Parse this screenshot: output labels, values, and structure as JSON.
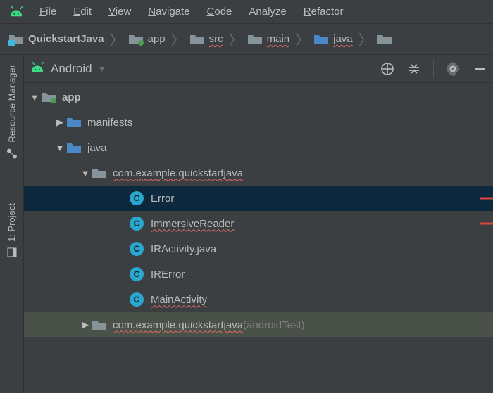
{
  "menu": {
    "file": "File",
    "edit": "Edit",
    "view": "View",
    "navigate": "Navigate",
    "code": "Code",
    "analyze": "Analyze",
    "refactor": "Refactor"
  },
  "crumbs": {
    "root": "QuickstartJava",
    "module": "app",
    "src": "src",
    "main": "main",
    "java": "java"
  },
  "panel": {
    "view_label": "Android"
  },
  "sidebar": {
    "resource_mgr": "Resource Manager",
    "project": "1: Project"
  },
  "tree": {
    "app": "app",
    "manifests": "manifests",
    "java": "java",
    "pkg": "com.example.quickstartjava",
    "files": {
      "error": "Error",
      "immersive": "ImmersiveReader",
      "iractivity": "IRActivity.java",
      "irerror": "IRError",
      "main": "MainActivity"
    },
    "pkg_test": "com.example.quickstartjava",
    "pkg_test_suffix": " (androidTest)"
  }
}
